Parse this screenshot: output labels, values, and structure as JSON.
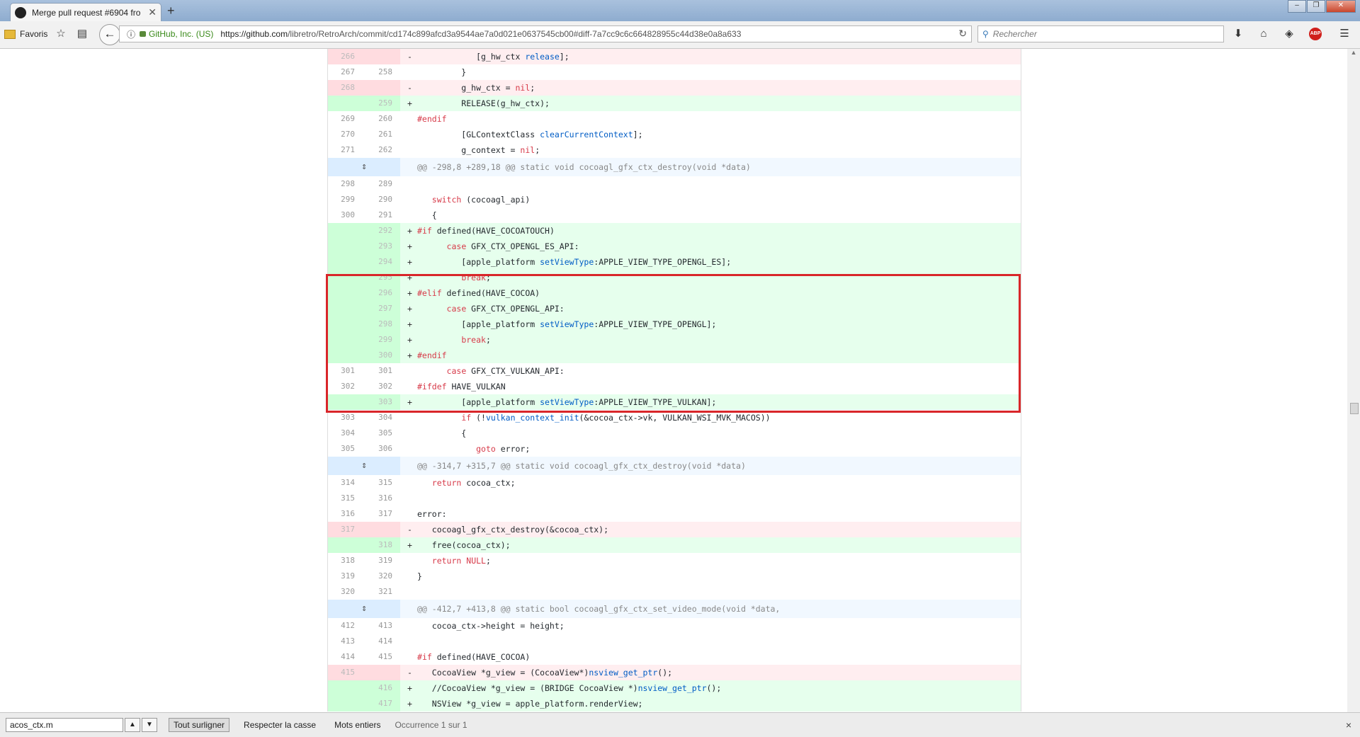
{
  "browser": {
    "tab_title": "Merge pull request #6904 fro",
    "tab_close": "✕",
    "new_tab": "+",
    "bookmarks_label": "Favoris",
    "site_identity": "GitHub, Inc. (US)",
    "url_host": "https://github.com",
    "url_path": "/libretro/RetroArch/commit/cd174c899afcd3a9544ae7a0d021e0637545cb00#diff-7a7cc9c6c664828955c44d38e0a8a633",
    "search_placeholder": "Rechercher",
    "abp_label": "ABP"
  },
  "diff_rows": [
    {
      "type": "del",
      "old": "266",
      "new": "",
      "mark": "-",
      "code": "            [g_hw_ctx release];"
    },
    {
      "type": "ctx",
      "old": "267",
      "new": "258",
      "mark": "",
      "code": "         }"
    },
    {
      "type": "del",
      "old": "268",
      "new": "",
      "mark": "-",
      "code": "         g_hw_ctx = nil;"
    },
    {
      "type": "add",
      "old": "",
      "new": "259",
      "mark": "+",
      "code": "         RELEASE(g_hw_ctx);"
    },
    {
      "type": "ctx",
      "old": "269",
      "new": "260",
      "mark": "",
      "code": "#endif"
    },
    {
      "type": "ctx",
      "old": "270",
      "new": "261",
      "mark": "",
      "code": "         [GLContextClass clearCurrentContext];"
    },
    {
      "type": "ctx",
      "old": "271",
      "new": "262",
      "mark": "",
      "code": "         g_context = nil;"
    },
    {
      "type": "hunk",
      "old": "",
      "new": "",
      "mark": "",
      "code": "@@ -298,8 +289,18 @@ static void cocoagl_gfx_ctx_destroy(void *data)"
    },
    {
      "type": "ctx",
      "old": "298",
      "new": "289",
      "mark": "",
      "code": ""
    },
    {
      "type": "ctx",
      "old": "299",
      "new": "290",
      "mark": "",
      "code": "   switch (cocoagl_api)"
    },
    {
      "type": "ctx",
      "old": "300",
      "new": "291",
      "mark": "",
      "code": "   {"
    },
    {
      "type": "add",
      "old": "",
      "new": "292",
      "mark": "+",
      "code": "#if defined(HAVE_COCOATOUCH)"
    },
    {
      "type": "add",
      "old": "",
      "new": "293",
      "mark": "+",
      "code": "      case GFX_CTX_OPENGL_ES_API:"
    },
    {
      "type": "add",
      "old": "",
      "new": "294",
      "mark": "+",
      "code": "         [apple_platform setViewType:APPLE_VIEW_TYPE_OPENGL_ES];"
    },
    {
      "type": "add",
      "old": "",
      "new": "295",
      "mark": "+",
      "code": "         break;"
    },
    {
      "type": "add",
      "old": "",
      "new": "296",
      "mark": "+",
      "code": "#elif defined(HAVE_COCOA)"
    },
    {
      "type": "add",
      "old": "",
      "new": "297",
      "mark": "+",
      "code": "      case GFX_CTX_OPENGL_API:"
    },
    {
      "type": "add",
      "old": "",
      "new": "298",
      "mark": "+",
      "code": "         [apple_platform setViewType:APPLE_VIEW_TYPE_OPENGL];"
    },
    {
      "type": "add",
      "old": "",
      "new": "299",
      "mark": "+",
      "code": "         break;"
    },
    {
      "type": "add",
      "old": "",
      "new": "300",
      "mark": "+",
      "code": "#endif"
    },
    {
      "type": "ctx",
      "old": "301",
      "new": "301",
      "mark": "",
      "code": "      case GFX_CTX_VULKAN_API:"
    },
    {
      "type": "ctx",
      "old": "302",
      "new": "302",
      "mark": "",
      "code": "#ifdef HAVE_VULKAN"
    },
    {
      "type": "add",
      "old": "",
      "new": "303",
      "mark": "+",
      "code": "         [apple_platform setViewType:APPLE_VIEW_TYPE_VULKAN];"
    },
    {
      "type": "ctx",
      "old": "303",
      "new": "304",
      "mark": "",
      "code": "         if (!vulkan_context_init(&cocoa_ctx->vk, VULKAN_WSI_MVK_MACOS))"
    },
    {
      "type": "ctx",
      "old": "304",
      "new": "305",
      "mark": "",
      "code": "         {"
    },
    {
      "type": "ctx",
      "old": "305",
      "new": "306",
      "mark": "",
      "code": "            goto error;"
    },
    {
      "type": "hunk",
      "old": "",
      "new": "",
      "mark": "",
      "code": "@@ -314,7 +315,7 @@ static void cocoagl_gfx_ctx_destroy(void *data)"
    },
    {
      "type": "ctx",
      "old": "314",
      "new": "315",
      "mark": "",
      "code": "   return cocoa_ctx;"
    },
    {
      "type": "ctx",
      "old": "315",
      "new": "316",
      "mark": "",
      "code": ""
    },
    {
      "type": "ctx",
      "old": "316",
      "new": "317",
      "mark": "",
      "code": "error:"
    },
    {
      "type": "del",
      "old": "317",
      "new": "",
      "mark": "-",
      "code": "   cocoagl_gfx_ctx_destroy(&cocoa_ctx);"
    },
    {
      "type": "add",
      "old": "",
      "new": "318",
      "mark": "+",
      "code": "   free(cocoa_ctx);"
    },
    {
      "type": "ctx",
      "old": "318",
      "new": "319",
      "mark": "",
      "code": "   return NULL;"
    },
    {
      "type": "ctx",
      "old": "319",
      "new": "320",
      "mark": "",
      "code": "}"
    },
    {
      "type": "ctx",
      "old": "320",
      "new": "321",
      "mark": "",
      "code": ""
    },
    {
      "type": "hunk",
      "old": "",
      "new": "",
      "mark": "",
      "code": "@@ -412,7 +413,8 @@ static bool cocoagl_gfx_ctx_set_video_mode(void *data,"
    },
    {
      "type": "ctx",
      "old": "412",
      "new": "413",
      "mark": "",
      "code": "   cocoa_ctx->height = height;"
    },
    {
      "type": "ctx",
      "old": "413",
      "new": "414",
      "mark": "",
      "code": ""
    },
    {
      "type": "ctx",
      "old": "414",
      "new": "415",
      "mark": "",
      "code": "#if defined(HAVE_COCOA)"
    },
    {
      "type": "del",
      "old": "415",
      "new": "",
      "mark": "-",
      "code": "   CocoaView *g_view = (CocoaView*)nsview_get_ptr();"
    },
    {
      "type": "add",
      "old": "",
      "new": "416",
      "mark": "+",
      "code": "   //CocoaView *g_view = (BRIDGE CocoaView *)nsview_get_ptr();"
    },
    {
      "type": "add",
      "old": "",
      "new": "417",
      "mark": "+",
      "code": "   NSView *g_view = apple_platform.renderView;"
    }
  ],
  "expand_icon_glyph": "⇕",
  "find_bar": {
    "query": "acos_ctx.m",
    "highlight_all": "Tout surligner",
    "match_case": "Respecter la casse",
    "whole_words": "Mots entiers",
    "status": "Occurrence 1 sur 1",
    "close": "×"
  }
}
